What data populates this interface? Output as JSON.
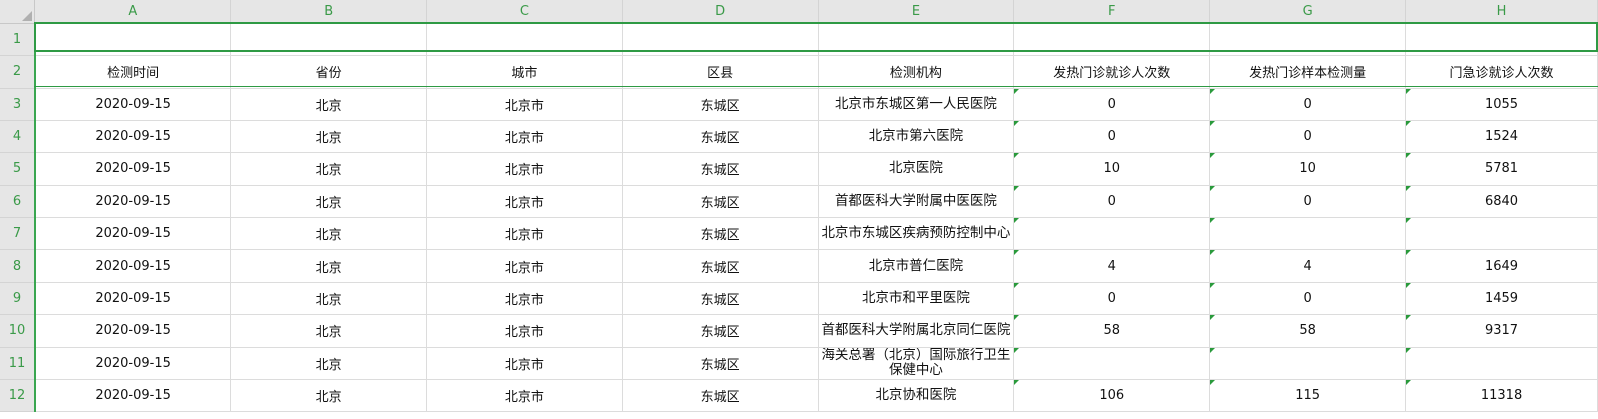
{
  "columns": [
    "A",
    "B",
    "C",
    "D",
    "E",
    "F",
    "G",
    "H"
  ],
  "header_row": [
    "检测时间",
    "省份",
    "城市",
    "区县",
    "检测机构",
    "发热门诊就诊人次数",
    "发热门诊样本检测量",
    "门急诊就诊人次数"
  ],
  "rows": [
    {
      "num": "3",
      "cells": [
        "2020-09-15",
        "北京",
        "北京市",
        "东城区",
        "北京市东城区第一人民医院",
        "0",
        "0",
        "1055"
      ]
    },
    {
      "num": "4",
      "cells": [
        "2020-09-15",
        "北京",
        "北京市",
        "东城区",
        "北京市第六医院",
        "0",
        "0",
        "1524"
      ]
    },
    {
      "num": "5",
      "cells": [
        "2020-09-15",
        "北京",
        "北京市",
        "东城区",
        "北京医院",
        "10",
        "10",
        "5781"
      ]
    },
    {
      "num": "6",
      "cells": [
        "2020-09-15",
        "北京",
        "北京市",
        "东城区",
        "首都医科大学附属中医医院",
        "0",
        "0",
        "6840"
      ]
    },
    {
      "num": "7",
      "cells": [
        "2020-09-15",
        "北京",
        "北京市",
        "东城区",
        "北京市东城区疾病预防控制中心",
        "",
        "",
        ""
      ]
    },
    {
      "num": "8",
      "cells": [
        "2020-09-15",
        "北京",
        "北京市",
        "东城区",
        "北京市普仁医院",
        "4",
        "4",
        "1649"
      ]
    },
    {
      "num": "9",
      "cells": [
        "2020-09-15",
        "北京",
        "北京市",
        "东城区",
        "北京市和平里医院",
        "0",
        "0",
        "1459"
      ]
    },
    {
      "num": "10",
      "cells": [
        "2020-09-15",
        "北京",
        "北京市",
        "东城区",
        "首都医科大学附属北京同仁医院",
        "58",
        "58",
        "9317"
      ]
    },
    {
      "num": "11",
      "cells": [
        "2020-09-15",
        "北京",
        "北京市",
        "东城区",
        "海关总署（北京）国际旅行卫生保健中心",
        "",
        "",
        ""
      ]
    },
    {
      "num": "12",
      "cells": [
        "2020-09-15",
        "北京",
        "北京市",
        "东城区",
        "北京协和医院",
        "106",
        "115",
        "11318"
      ]
    }
  ],
  "row_numbers_top": [
    "1",
    "2"
  ],
  "colors": {
    "selection": "#2e9a44",
    "header_text": "#3a9a48",
    "header_bg": "#e6e6e6"
  }
}
